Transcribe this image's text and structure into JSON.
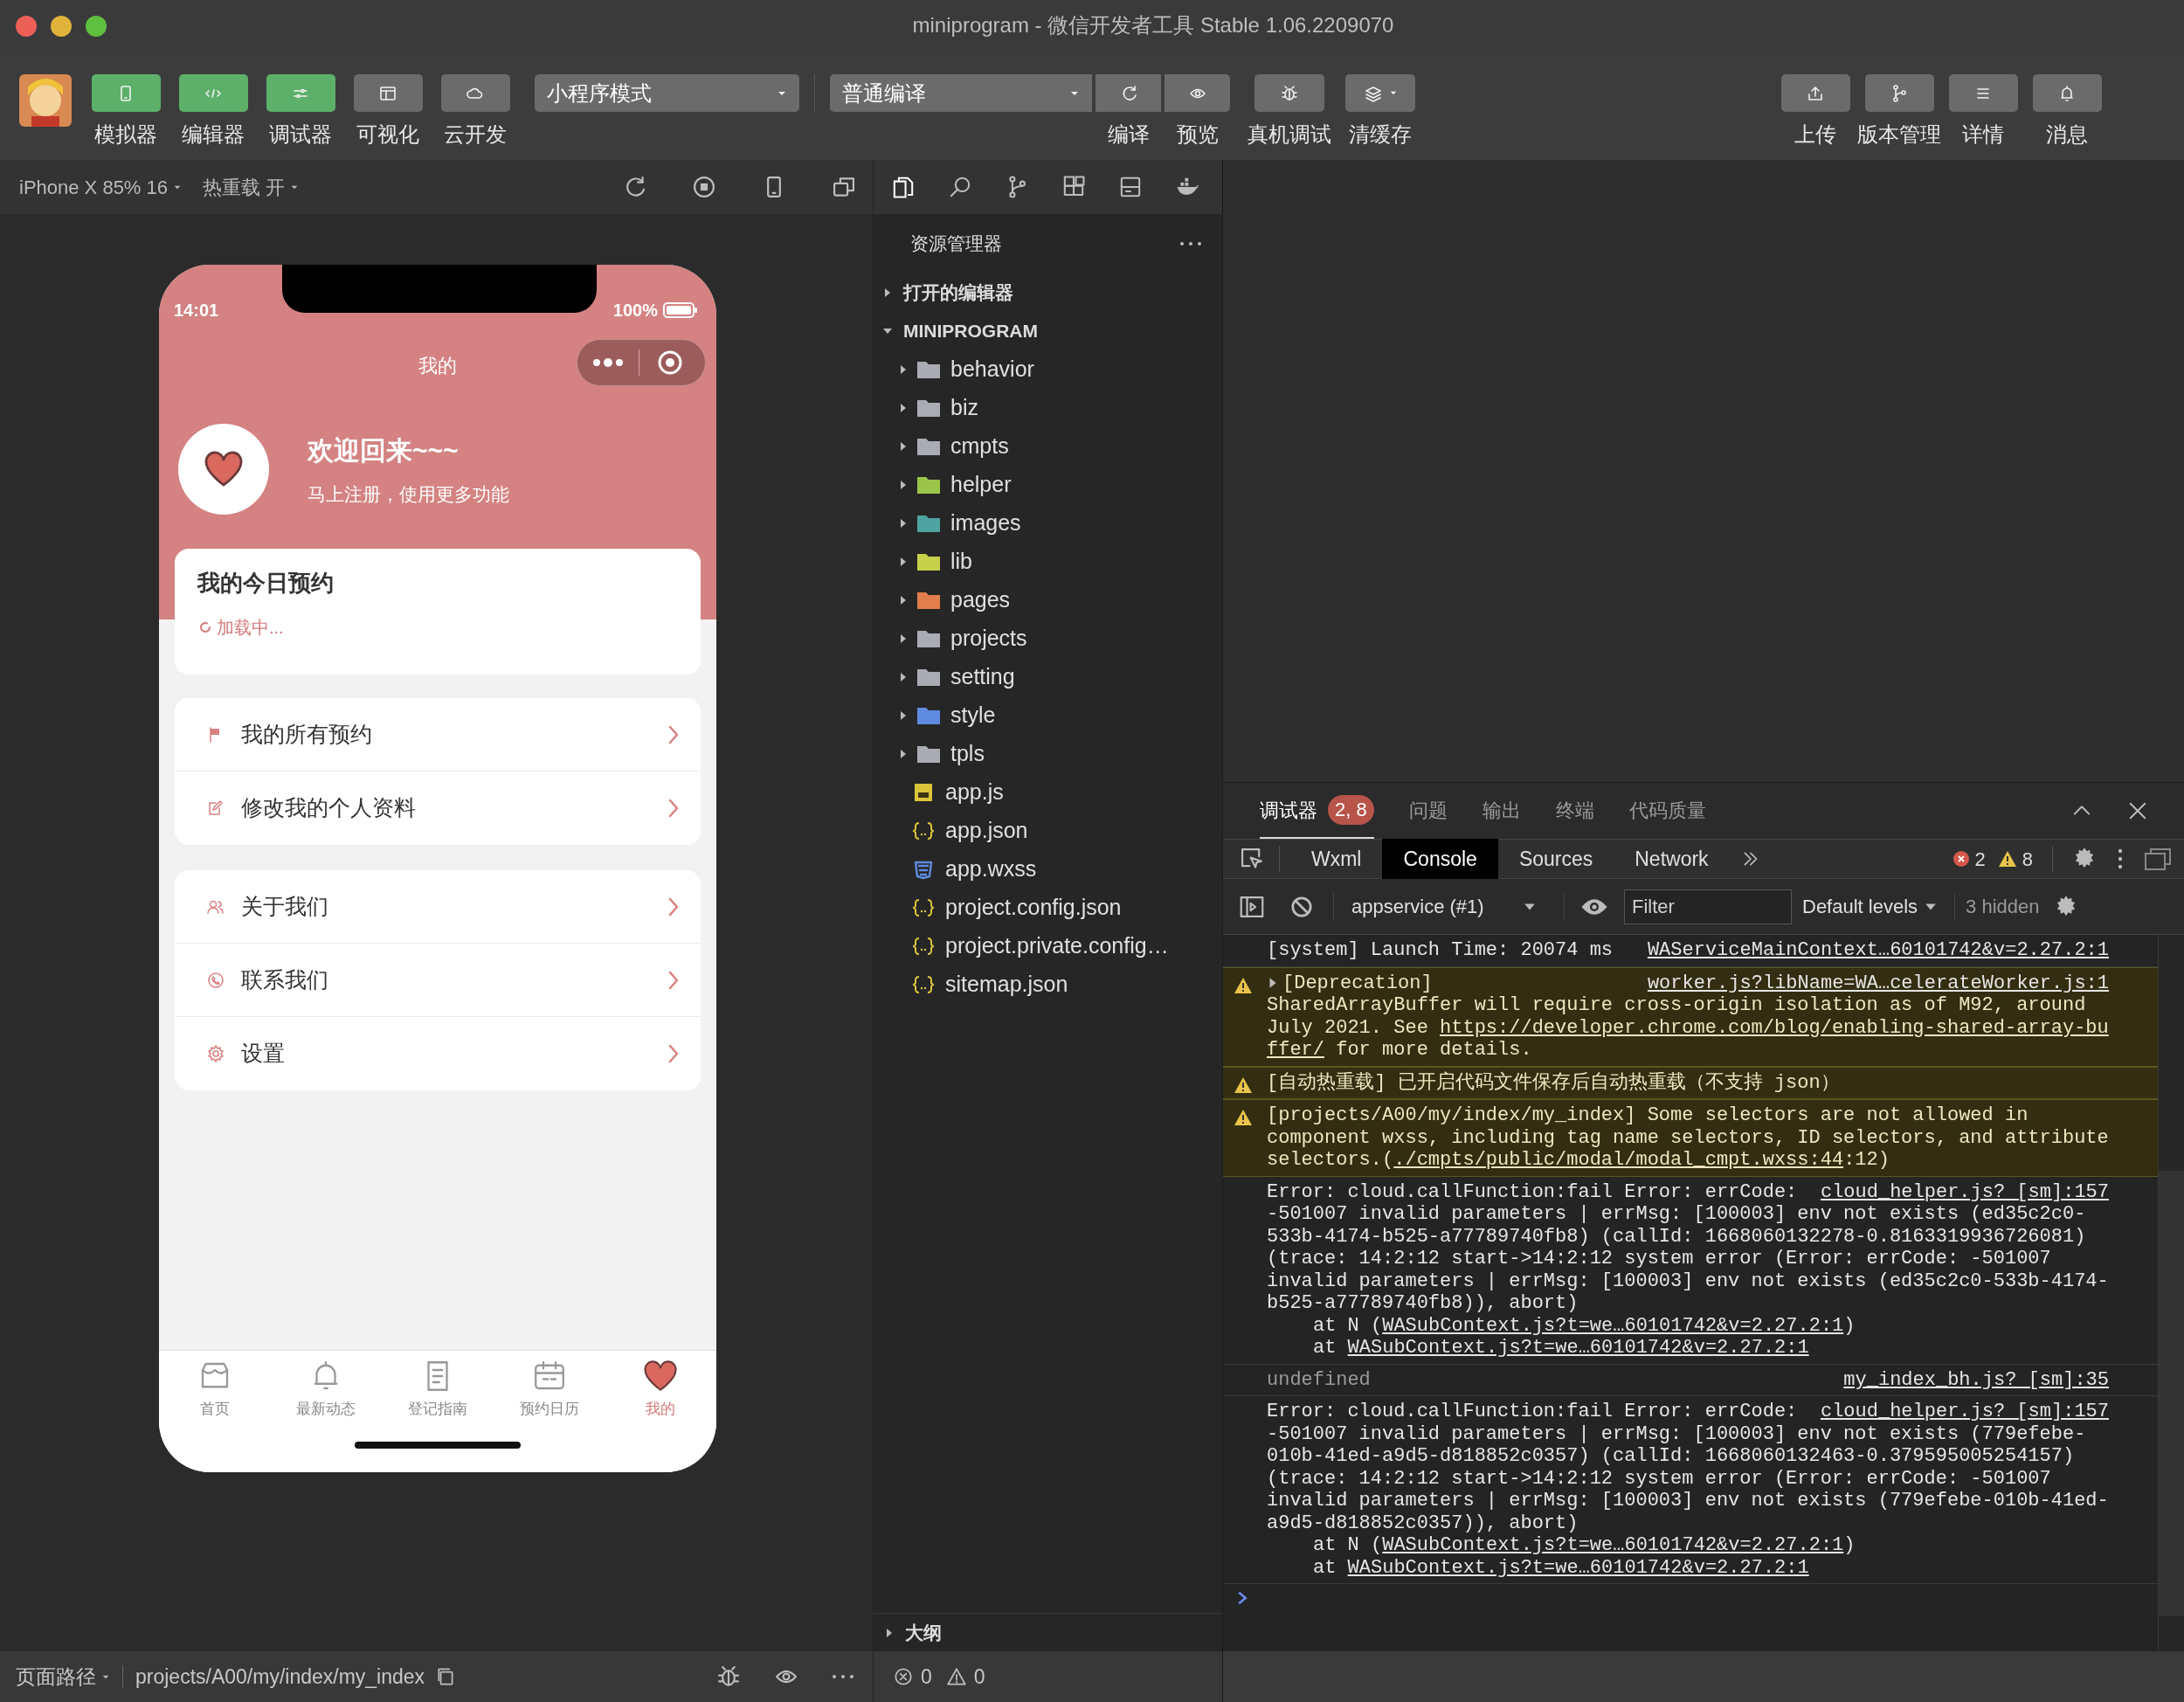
{
  "window": {
    "title": "miniprogram - 微信开发者工具 Stable 1.06.2209070"
  },
  "toolbar": {
    "left_buttons": [
      {
        "label": "模拟器",
        "on": true
      },
      {
        "label": "编辑器",
        "on": true
      },
      {
        "label": "调试器",
        "on": true
      },
      {
        "label": "可视化",
        "on": false
      },
      {
        "label": "云开发",
        "on": false
      }
    ],
    "mode_dropdown": "小程序模式",
    "compile_dropdown": "普通编译",
    "compile_buttons": [
      {
        "label": "编译"
      },
      {
        "label": "预览"
      }
    ],
    "tool_buttons": [
      {
        "label": "真机调试"
      },
      {
        "label": "清缓存"
      }
    ],
    "right_buttons": [
      {
        "label": "上传"
      },
      {
        "label": "版本管理"
      },
      {
        "label": "详情"
      },
      {
        "label": "消息"
      }
    ]
  },
  "simulator_toolbar": {
    "device": "iPhone X 85% 16",
    "hot_reload": "热重载 开"
  },
  "phone": {
    "time": "14:01",
    "battery": "100%",
    "title": "我的",
    "welcome": "欢迎回来~~~",
    "subtitle": "马上注册，使用更多功能",
    "today_card": {
      "title": "我的今日预约",
      "status": "加载中..."
    },
    "menu_groups": [
      [
        {
          "label": "我的所有预约"
        },
        {
          "label": "修改我的个人资料"
        }
      ],
      [
        {
          "label": "关于我们"
        },
        {
          "label": "联系我们"
        },
        {
          "label": "设置"
        }
      ]
    ],
    "tabs": [
      {
        "label": "首页",
        "selected": false
      },
      {
        "label": "最新动态",
        "selected": false
      },
      {
        "label": "登记指南",
        "selected": false
      },
      {
        "label": "预约日历",
        "selected": false
      },
      {
        "label": "我的",
        "selected": true
      }
    ]
  },
  "explorer": {
    "title": "资源管理器",
    "sections": [
      {
        "label": "打开的编辑器",
        "expanded": false
      },
      {
        "label": "MINIPROGRAM",
        "expanded": true
      }
    ],
    "items": [
      {
        "name": "behavior",
        "kind": "folder",
        "color": "#a9adb3"
      },
      {
        "name": "biz",
        "kind": "folder",
        "color": "#a9adb3"
      },
      {
        "name": "cmpts",
        "kind": "folder",
        "color": "#a9adb3"
      },
      {
        "name": "helper",
        "kind": "folder",
        "color": "#9cc44a"
      },
      {
        "name": "images",
        "kind": "folder",
        "color": "#4fa3a0"
      },
      {
        "name": "lib",
        "kind": "folder",
        "color": "#c6d04a"
      },
      {
        "name": "pages",
        "kind": "folder",
        "color": "#e27d4c"
      },
      {
        "name": "projects",
        "kind": "folder",
        "color": "#a9adb3"
      },
      {
        "name": "setting",
        "kind": "folder",
        "color": "#a9adb3"
      },
      {
        "name": "style",
        "kind": "folder",
        "color": "#5f8be0"
      },
      {
        "name": "tpls",
        "kind": "folder",
        "color": "#a9adb3"
      },
      {
        "name": "app.js",
        "kind": "js",
        "color": "#d9c43a"
      },
      {
        "name": "app.json",
        "kind": "json",
        "color": "#d9c43a"
      },
      {
        "name": "app.wxss",
        "kind": "wxss",
        "color": "#5f8be0"
      },
      {
        "name": "project.config.json",
        "kind": "json",
        "color": "#d9c43a"
      },
      {
        "name": "project.private.config…",
        "kind": "json",
        "color": "#d9c43a"
      },
      {
        "name": "sitemap.json",
        "kind": "json",
        "color": "#d9c43a"
      }
    ],
    "outline": "大纲",
    "problems": {
      "errors": "0",
      "warnings": "0"
    }
  },
  "status_bar": {
    "page_path_label": "页面路径",
    "path": "projects/A00/my/index/my_index"
  },
  "debugger": {
    "tabs": [
      {
        "label": "调试器",
        "selected": true,
        "badge": "2, 8"
      },
      {
        "label": "问题",
        "selected": false
      },
      {
        "label": "输出",
        "selected": false
      },
      {
        "label": "终端",
        "selected": false
      },
      {
        "label": "代码质量",
        "selected": false
      }
    ],
    "devtools_tabs": [
      {
        "label": "Wxml",
        "selected": false
      },
      {
        "label": "Console",
        "selected": true
      },
      {
        "label": "Sources",
        "selected": false
      },
      {
        "label": "Network",
        "selected": false
      }
    ],
    "error_count": "2",
    "warning_count": "8",
    "context": "appservice (#1)",
    "filter": {
      "placeholder": "Filter"
    },
    "levels": "Default levels",
    "hidden": "3 hidden",
    "entries": [
      {
        "kind": "log",
        "source": "WAServiceMainContext…60101742&v=2.27.2:1",
        "lines": [
          {
            "text": "[system] Launch Time: 20074 ms"
          }
        ]
      },
      {
        "kind": "warning",
        "expandable": true,
        "source": "worker.js?libName=WA…celerateWorker.js:1",
        "lines": [
          {
            "text": "[Deprecation]"
          },
          {
            "text": "SharedArrayBuffer will require cross-origin isolation as of M92, around"
          },
          {
            "text": "July 2021. See ",
            "link": "https://developer.chrome.com/blog/enabling-shared-array-bu"
          },
          {
            "link": "ffer/",
            "after": " for more details."
          }
        ]
      },
      {
        "kind": "warning",
        "lines": [
          {
            "text": "[自动热重载] 已开启代码文件保存后自动热重载（不支持 json）"
          }
        ]
      },
      {
        "kind": "warning",
        "lines": [
          {
            "text": "[projects/A00/my/index/my_index] Some selectors are not allowed in"
          },
          {
            "text": "component wxss, including tag name selectors, ID selectors, and attribute"
          },
          {
            "text": "selectors.(",
            "link": "./cmpts/public/modal/modal_cmpt.wxss:44",
            "after": ":12)"
          }
        ]
      },
      {
        "kind": "log",
        "source": "cloud_helper.js? [sm]:157",
        "lines": [
          {
            "text": "Error: cloud.callFunction:fail Error: errCode:"
          },
          {
            "text": "-501007 invalid parameters | errMsg: [100003] env not exists (ed35c2c0-"
          },
          {
            "text": "533b-4174-b525-a77789740fb8) (callId: 1668060132278-0.8163319936726081)"
          },
          {
            "text": "(trace: 14:2:12 start->14:2:12 system error (Error: errCode: -501007"
          },
          {
            "text": "invalid parameters | errMsg: [100003] env not exists (ed35c2c0-533b-4174-"
          },
          {
            "text": "b525-a77789740fb8)), abort)"
          },
          {
            "indent": true,
            "text": "at N (",
            "link": "WASubContext.js?t=we…60101742&v=2.27.2:1",
            "after": ")"
          },
          {
            "indent": true,
            "text": "at ",
            "link": "WASubContext.js?t=we…60101742&v=2.27.2:1"
          }
        ]
      },
      {
        "kind": "result",
        "source": "my_index_bh.js? [sm]:35",
        "lines": [
          {
            "text": "undefined"
          }
        ]
      },
      {
        "kind": "log",
        "source": "cloud_helper.js? [sm]:157",
        "lines": [
          {
            "text": "Error: cloud.callFunction:fail Error: errCode:"
          },
          {
            "text": "-501007 invalid parameters | errMsg: [100003] env not exists (779efebe-"
          },
          {
            "text": "010b-41ed-a9d5-d818852c0357) (callId: 1668060132463-0.379595005254157)"
          },
          {
            "text": "(trace: 14:2:12 start->14:2:12 system error (Error: errCode: -501007"
          },
          {
            "text": "invalid parameters | errMsg: [100003] env not exists (779efebe-010b-41ed-"
          },
          {
            "text": "a9d5-d818852c0357)), abort)"
          },
          {
            "indent": true,
            "text": "at N (",
            "link": "WASubContext.js?t=we…60101742&v=2.27.2:1",
            "after": ")"
          },
          {
            "indent": true,
            "text": "at ",
            "link": "WASubContext.js?t=we…60101742&v=2.27.2:1"
          }
        ]
      }
    ]
  }
}
